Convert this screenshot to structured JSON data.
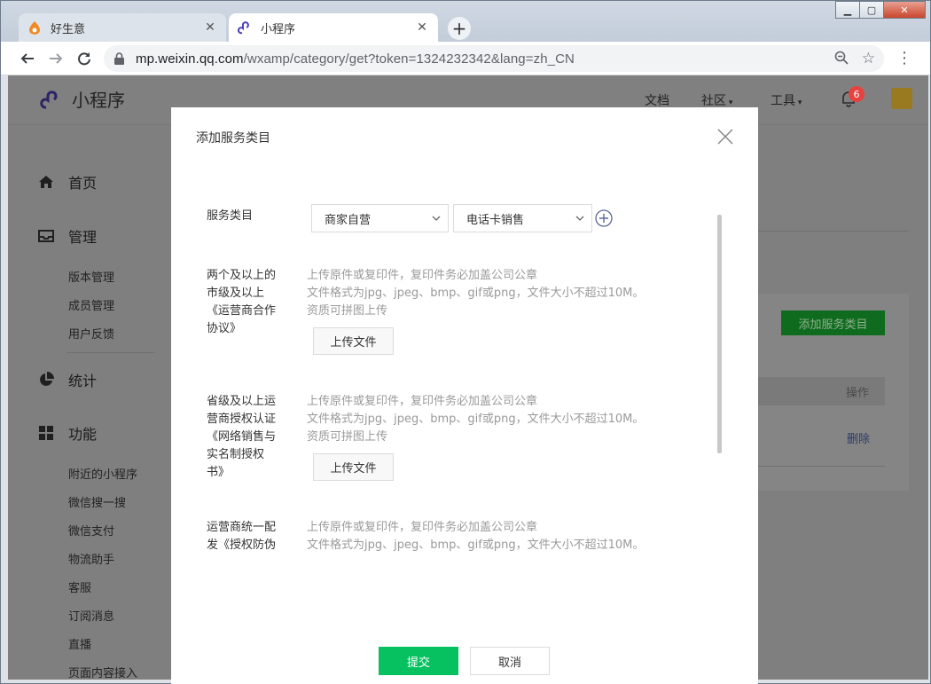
{
  "browser": {
    "tabs": [
      {
        "label": "好生意",
        "active": false
      },
      {
        "label": "小程序",
        "active": true
      }
    ],
    "url_host": "mp.weixin.qq.com",
    "url_rest": "/wxamp/category/get?token=1324232342&lang=zh_CN"
  },
  "header": {
    "logo_text": "小程序",
    "nav": {
      "docs": "文档",
      "community": "社区",
      "tools": "工具"
    },
    "notification_count": "6"
  },
  "sidebar": {
    "groups": [
      {
        "label": "首页",
        "icon": "home-icon"
      },
      {
        "label": "管理",
        "icon": "inbox-icon",
        "items": [
          "版本管理",
          "成员管理",
          "用户反馈"
        ]
      },
      {
        "label": "统计",
        "icon": "pie-chart-icon"
      },
      {
        "label": "功能",
        "icon": "grid-icon",
        "items": [
          "附近的小程序",
          "微信搜一搜",
          "微信支付",
          "物流助手",
          "客服",
          "订阅消息",
          "直播",
          "页面内容接入"
        ]
      }
    ]
  },
  "main": {
    "add_category_button": "添加服务类目",
    "op_header": "操作",
    "delete_link": "删除"
  },
  "modal": {
    "title": "添加服务类目",
    "service_category_label": "服务类目",
    "select1_value": "商家自营",
    "select2_value": "电话卡销售",
    "sections": [
      {
        "label_lines": [
          "两个及以上的",
          "市级及以上",
          "《运营商合作",
          "协议》"
        ],
        "hints": [
          "上传原件或复印件，复印件务必加盖公司公章",
          "文件格式为jpg、jpeg、bmp、gif或png，文件大小不超过10M。",
          "资质可拼图上传"
        ],
        "upload_label": "上传文件"
      },
      {
        "label_lines": [
          "省级及以上运",
          "营商授权认证",
          "《网络销售与",
          "实名制授权",
          "书》"
        ],
        "hints": [
          "上传原件或复印件，复印件务必加盖公司公章",
          "文件格式为jpg、jpeg、bmp、gif或png，文件大小不超过10M。",
          "资质可拼图上传"
        ],
        "upload_label": "上传文件"
      },
      {
        "label_lines": [
          "运营商统一配",
          "发《授权防伪"
        ],
        "hints": [
          "上传原件或复印件，复印件务必加盖公司公章",
          "文件格式为jpg、jpeg、bmp、gif或png，文件大小不超过10M。"
        ]
      }
    ],
    "submit_label": "提交",
    "cancel_label": "取消"
  },
  "colors": {
    "primary_green": "#07c160",
    "badge_red": "#e64340",
    "brand_purple": "#4a3fbf"
  }
}
